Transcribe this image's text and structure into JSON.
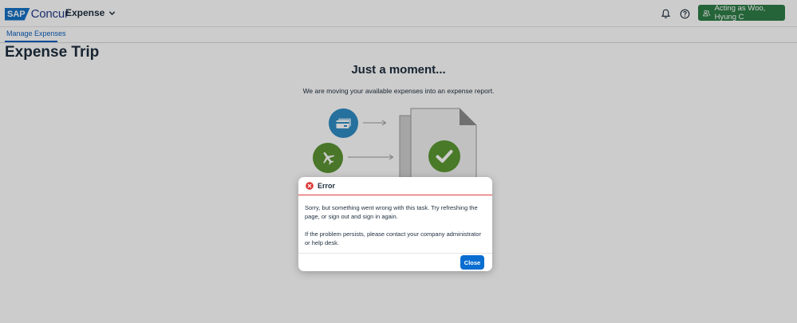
{
  "header": {
    "logo_sap": "SAP",
    "logo_concur": "Concur",
    "app_menu_label": "Expense",
    "acting_as_label": "Acting as Woo, Hyung C"
  },
  "subnav": {
    "active_tab": "Manage Expenses"
  },
  "page": {
    "title": "Expense Trip"
  },
  "loading": {
    "title": "Just a moment...",
    "subtitle": "We are moving your available expenses into an expense report."
  },
  "dialog": {
    "title": "Error",
    "paragraph1": "Sorry, but something went wrong with this task. Try refreshing the page, or sign out and sign in again.",
    "paragraph2": "If the problem persists, please contact your company administrator or help desk.",
    "close_label": "Close"
  },
  "colors": {
    "brand_blue": "#1672c6",
    "acting_green": "#2e7d46",
    "error_red": "#e23d3d",
    "primary_button": "#0a6ed1",
    "card_blue": "#2f8cc5",
    "plane_green": "#5c9433",
    "check_green": "#5a9933"
  },
  "icons": {
    "notification": "bell-icon",
    "help": "help-icon",
    "user": "user-group-icon",
    "error": "error-icon",
    "card": "credit-card-icon",
    "plane": "airplane-icon",
    "check": "checkmark-icon"
  }
}
